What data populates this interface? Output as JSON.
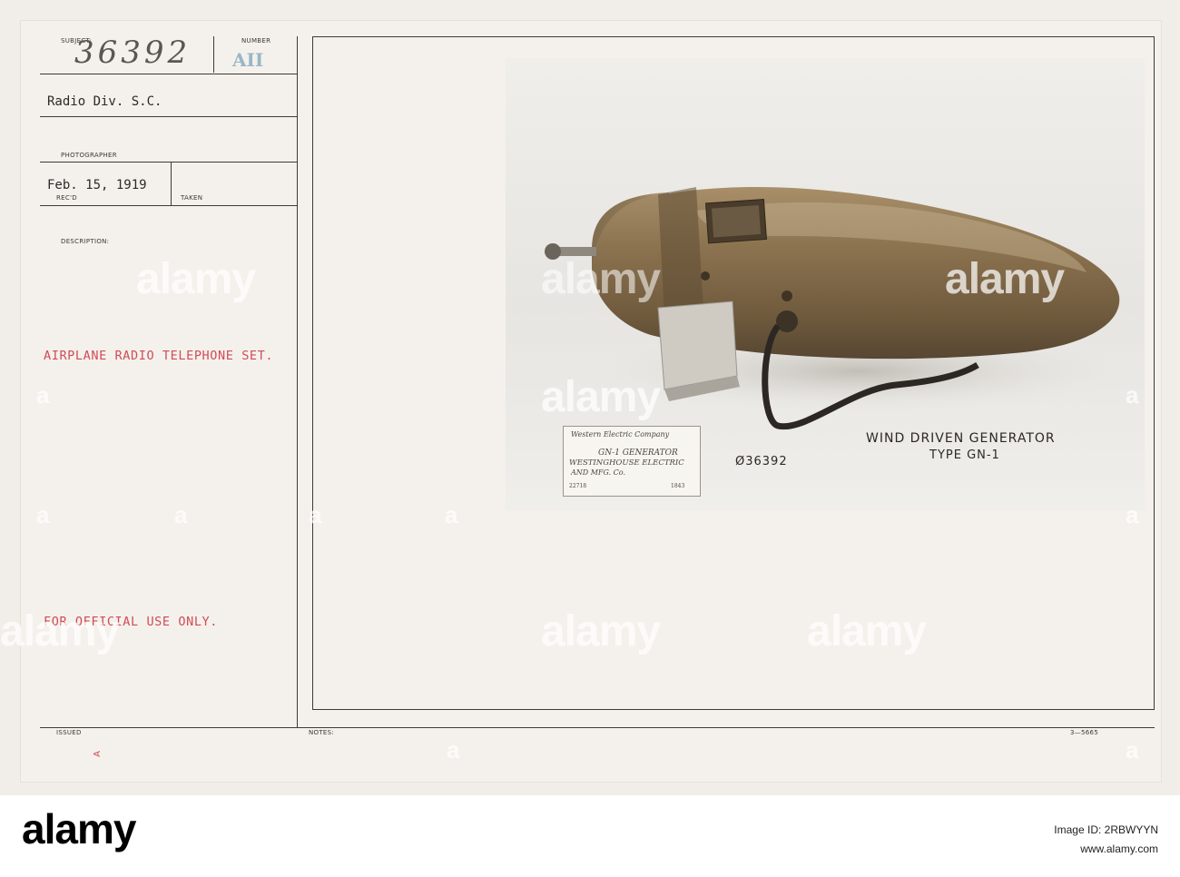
{
  "record": {
    "subject_label": "SUBJECT:",
    "number_label": "NUMBER",
    "subject_number": "36392",
    "number_stamp": "AII",
    "unit": "Radio Div. S.C.",
    "photographer_label": "PHOTOGRAPHER",
    "date": "Feb. 15, 1919",
    "recd_label": "REC'D",
    "taken_label": "TAKEN",
    "description_label": "DESCRIPTION:",
    "description": "AIRPLANE RADIO TELEPHONE SET.",
    "restriction": "FOR OFFICIAL USE ONLY.",
    "issued_label": "ISSUED",
    "notes_label": "NOTES:",
    "form_number": "3—5665",
    "issued_mark": "A"
  },
  "photo": {
    "caption_line1": "WIND DRIVEN GENERATOR",
    "caption_line2": "TYPE GN-1",
    "negative_number": "Ø36392",
    "label_card": {
      "company": "Western Electric Company",
      "line1": "GN-1 GENERATOR",
      "line2": "WESTINGHOUSE ELECTRIC",
      "line3": "AND MFG. Co.",
      "left_code": "22718",
      "right_code": "1843"
    }
  },
  "watermark": {
    "text": "alamy",
    "small": "a"
  },
  "footer": {
    "logo": "alamy",
    "image_id_label": "Image ID: 2RBWYYN",
    "site": "www.alamy.com"
  }
}
